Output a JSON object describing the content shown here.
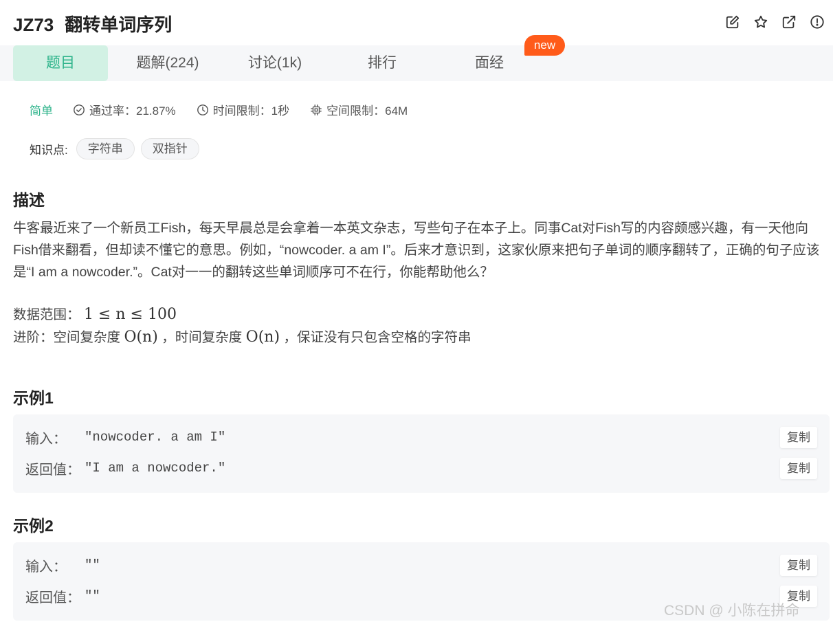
{
  "header": {
    "question_id": "JZ73",
    "title": "翻转单词序列",
    "icons": [
      "edit-icon",
      "star-icon",
      "external-link-icon",
      "info-icon"
    ]
  },
  "tabs": [
    {
      "label": "题目",
      "active": true
    },
    {
      "label": "题解(224)",
      "active": false
    },
    {
      "label": "讨论(1k)",
      "active": false
    },
    {
      "label": "排行",
      "active": false
    },
    {
      "label": "面经",
      "active": false
    }
  ],
  "new_badge": "new",
  "meta": {
    "difficulty": "简单",
    "pass_rate": "通过率：21.87%",
    "time_limit": "时间限制：1秒",
    "space_limit": "空间限制：64M"
  },
  "knowledge": {
    "label": "知识点:",
    "tags": [
      "字符串",
      "双指针"
    ]
  },
  "description": {
    "heading": "描述",
    "body": "牛客最近来了一个新员工Fish，每天早晨总是会拿着一本英文杂志，写些句子在本子上。同事Cat对Fish写的内容颇感兴趣，有一天他向Fish借来翻看，但却读不懂它的意思。例如，“nowcoder. a am I”。后来才意识到，这家伙原来把句子单词的顺序翻转了，正确的句子应该是“I am a nowcoder.”。Cat对一一的翻转这些单词顺序可不在行，你能帮助他么？",
    "range_label": "数据范围：",
    "range_math": "1 ≤ n ≤ 100",
    "advanced_label": "进阶：空间复杂度",
    "advanced_math_1": "O(n)",
    "advanced_mid": "，时间复杂度",
    "advanced_math_2": "O(n)",
    "advanced_tail": "，保证没有只包含空格的字符串"
  },
  "examples": [
    {
      "heading": "示例1",
      "input_label": "输入：",
      "input_value": "\"nowcoder. a am I\"",
      "output_label": "返回值：",
      "output_value": "\"I am a nowcoder.\"",
      "copy_label": "复制"
    },
    {
      "heading": "示例2",
      "input_label": "输入：",
      "input_value": "\"\"",
      "output_label": "返回值：",
      "output_value": "\"\"",
      "copy_label": "复制"
    }
  ],
  "watermark": "CSDN @ 小陈在拼命",
  "colors": {
    "accent": "#2cb38a",
    "tab_active_bg": "#d2f1e4",
    "new_badge": "#ff5b1a",
    "panel_bg": "#f6f7f9"
  }
}
